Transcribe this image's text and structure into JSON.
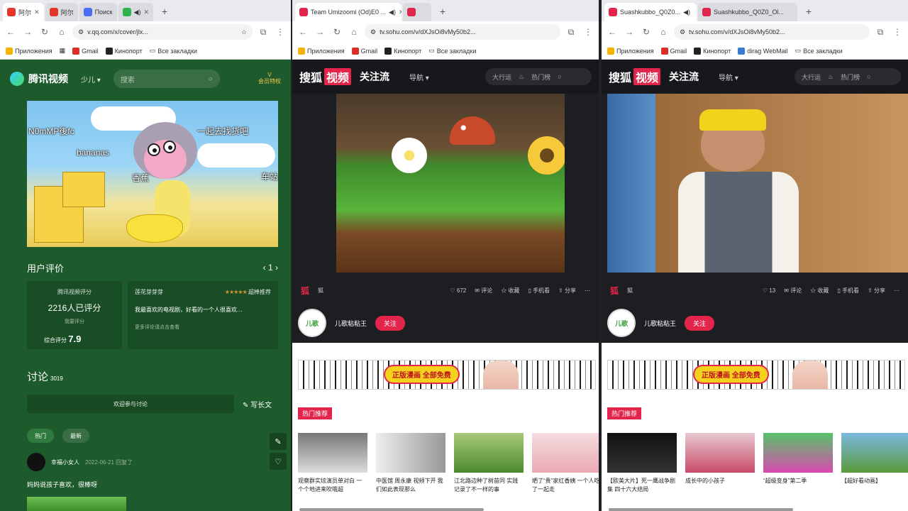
{
  "windows": [
    {
      "tabs": [
        {
          "label": "阿尔",
          "color": "#e4352b"
        },
        {
          "label": "阿尔",
          "color": "#e4352b"
        },
        {
          "label": "Поиск",
          "color": "#4a6cf7"
        },
        {
          "label": "",
          "color": "#2db34a"
        }
      ],
      "url": "v.qq.com/x/cover/jlx..."
    },
    {
      "tabs": [
        {
          "label": "Team Umizoomi (Od)E0 ...",
          "color": "#e3254b"
        },
        {
          "label": "",
          "color": "#e3254b"
        }
      ],
      "url": "tv.sohu.com/v/dXJsOi8vMy50b2..."
    },
    {
      "tabs": [
        {
          "label": "Suashkubbo_Q0Z0...",
          "color": "#e3254b"
        },
        {
          "label": "Suashkubbo_Q0Z0_Ol...",
          "color": "#e3254b"
        }
      ],
      "url": "tv.sohu.com/v/dXJsOi8vMy50b2..."
    }
  ],
  "bookmarks": {
    "apps": "Приложения",
    "gmail": "Gmail",
    "kinopoisk": "Кинопорт",
    "other": "Все закладки",
    "extra": "dirag WebMail"
  },
  "tencent": {
    "logo": "腾讯视频",
    "dropdown": "少儿",
    "search_placeholder": "搜索",
    "vip": "V",
    "vip_label": "会员特权",
    "subtitle_1": "N0mMP後fc",
    "subtitle_2": "bananas",
    "subtitle_3": "一起去找货吧",
    "subtitle_4": "香蕉",
    "subtitle_5": "车站",
    "rating_section": "用户评价",
    "pager": "1",
    "rating_title": "腾讯视频评分",
    "rating_count": "2216人已评分",
    "rating_sub": "我要评分",
    "rating_label": "综合评分",
    "rating_score": "7.9",
    "review_user": "莲花芽芽芽",
    "review_stars": "★★★★★",
    "review_tag": "超棒推荐",
    "review_body": "我最喜欢的电视剧，好看的一个人很喜欢…",
    "review_foot": "更多评论请点击查看",
    "discuss": "讨论",
    "discuss_count": "3019",
    "input_placeholder": "欢迎参与讨论",
    "write_label": "写长文",
    "pill_hot": "热门",
    "pill_new": "最新",
    "comment_user": "幸福小女人",
    "comment_time": "2022-06-21 回复了",
    "comment_text": "妈妈说孩子喜欢，很棒呀"
  },
  "sohu": {
    "logo": "搜狐",
    "logo_red": "视频",
    "follow_title": "关注流",
    "nav": "导航",
    "search_placeholder": "大行运",
    "hot": "热门榜",
    "author_avatar": "儿歌",
    "author": "儿歌粘粘王",
    "follow_btn": "关注",
    "ad_text": "正版漫画 全部免费",
    "hot_tag": "热门推荐",
    "ctrl_like": "672",
    "ctrl_comment": "评论",
    "ctrl_collect": "收藏",
    "ctrl_device": "手机看",
    "ctrl_share": "分享",
    "ctrl_like_2": "13",
    "win2_cards": [
      "观察群实炫演员单对白 一个个地进来吹哦超",
      "中医馆 周永康 视频下开 我们如此表现那么",
      "江北路边种了树苗同 实践记录了不一样的事",
      "晒了“贵”家红香姨 一个人吃了一起走"
    ],
    "win3_cards": [
      "【欧美大片】死一鹰战争剧集 四十六大结局",
      "成长中的小孩子",
      "“超级变身”第二季",
      "【超好看动画】"
    ]
  }
}
